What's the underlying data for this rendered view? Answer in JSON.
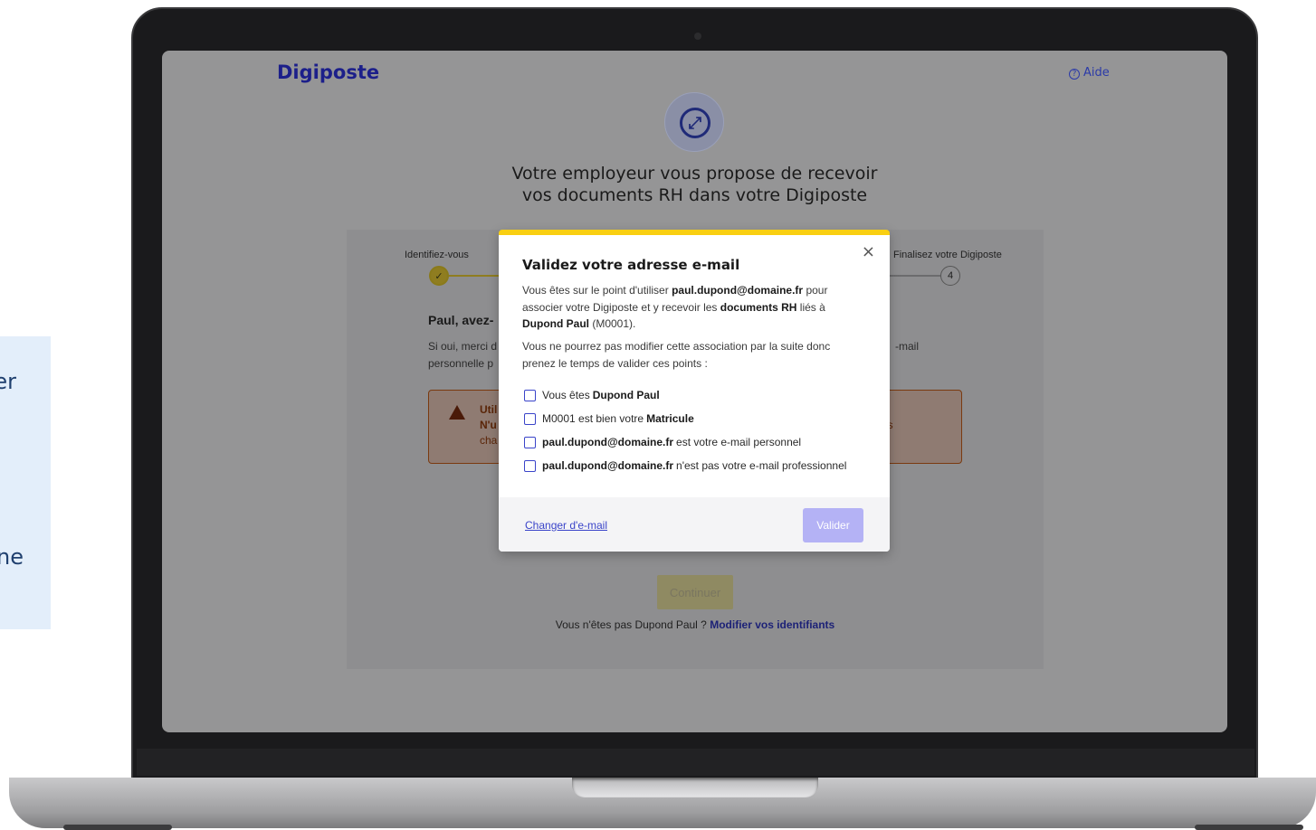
{
  "side_panel": {
    "line1": "er",
    "line2": "ne"
  },
  "header": {
    "logo": "Digiposte",
    "help_label": "Aide",
    "help_glyph": "?"
  },
  "hero": {
    "title_line1": "Votre employeur vous propose de recevoir",
    "title_line2": "vos documents RH dans votre Digiposte",
    "icon": "link-arrows-icon"
  },
  "stepper": {
    "step1_label": "Identifiez-vous",
    "step1_mark": "✓",
    "step4_label": "Finalisez votre Digiposte",
    "step4_number": "4"
  },
  "background_form": {
    "title": "Paul, avez-",
    "text_line1": "Si oui, merci d",
    "text_line2": "personnelle p",
    "text_right": "-mail",
    "warning_line1": "Util",
    "warning_line2": "N'u",
    "warning_line3": "cha",
    "warning_right1": "s.",
    "warning_right2": "us",
    "continue_label": "Continuer",
    "not_you_prefix": "Vous n'êtes pas Dupond Paul ?",
    "not_you_link": "Modifier vos identifiants"
  },
  "modal": {
    "title": "Validez votre adresse e-mail",
    "close_glyph": "×",
    "intro": {
      "p1": "Vous êtes sur le point d'utiliser",
      "email": "paul.dupond@domaine.fr",
      "p2": "pour associer votre Digiposte et y recevoir les",
      "docs": "documents RH",
      "p3": "liés à",
      "name_id": "Dupond Paul",
      "p4": "(M0001)."
    },
    "warning_text": "Vous ne pourrez pas modifier cette association par la suite donc prenez le temps de valider ces points :",
    "checks": [
      {
        "pre": "Vous êtes",
        "bold": "Dupond Paul",
        "post": ""
      },
      {
        "pre": "M0001 est bien votre",
        "bold": "Matricule",
        "post": ""
      },
      {
        "pre": "",
        "bold": "paul.dupond@domaine.fr",
        "post": "est votre e-mail personnel"
      },
      {
        "pre": "",
        "bold": "paul.dupond@domaine.fr",
        "post": "n'est pas votre e-mail professionnel"
      }
    ],
    "change_email_label": "Changer d'e-mail",
    "submit_label": "Valider"
  },
  "colors": {
    "brand": "#1c1f8a",
    "accent_yellow": "#f9cf12",
    "link": "#3a44c9",
    "button_disabled": "#b4b2f5"
  }
}
